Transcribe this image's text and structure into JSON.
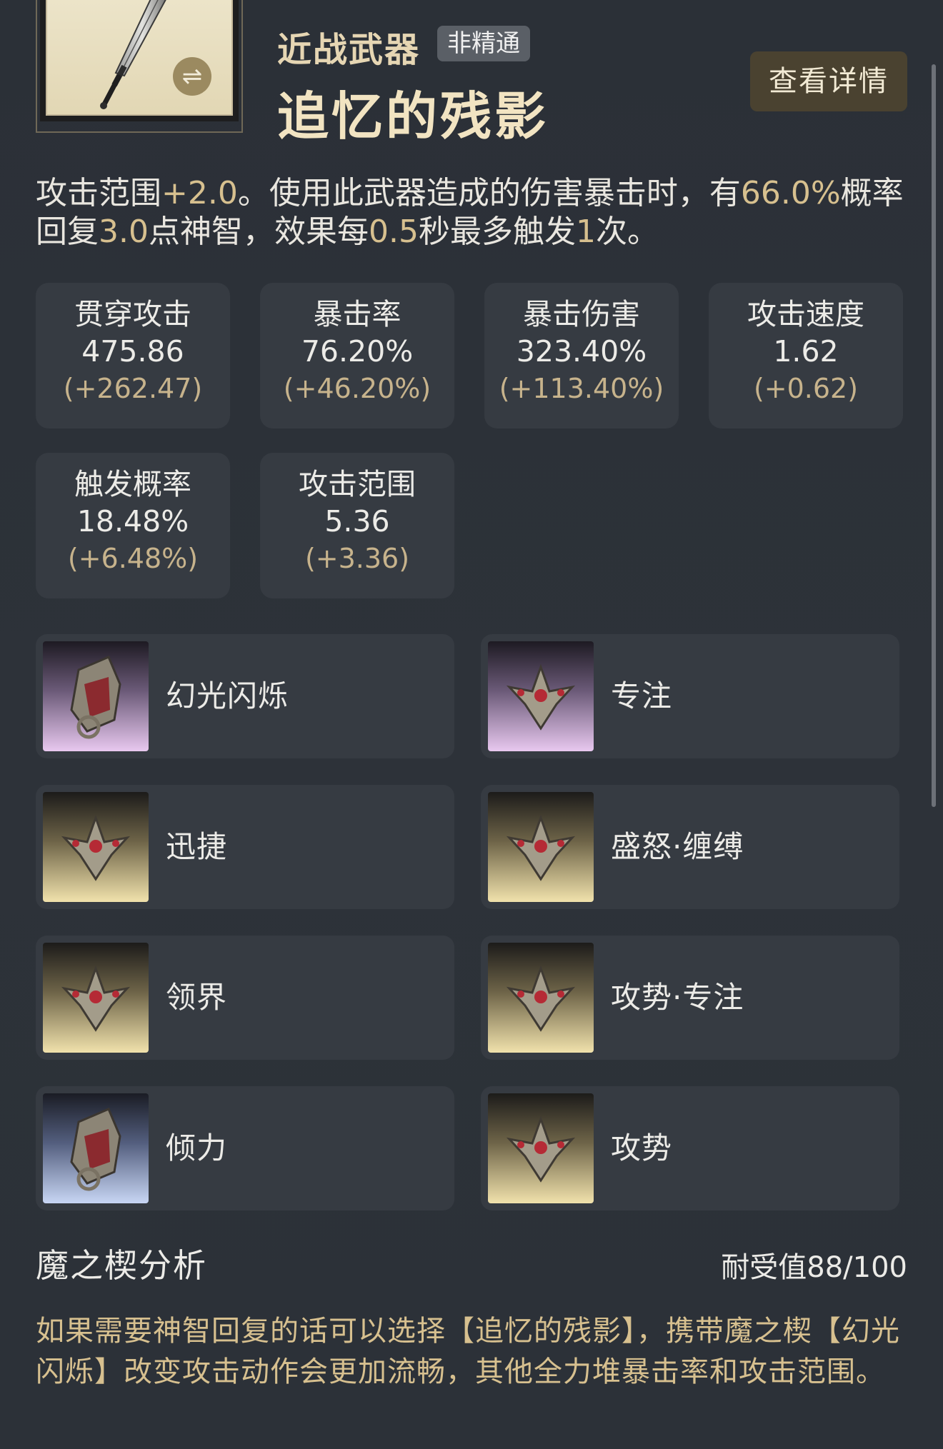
{
  "header": {
    "weapon_type": "近战武器",
    "badge": "非精通",
    "weapon_name": "追忆的残影",
    "detail_button": "查看详情",
    "swap_icon": "⇌"
  },
  "description": {
    "p1": "攻击范围",
    "v1": "+2.0",
    "p2": "。使用此武器造成的伤害暴击时，有",
    "v2": "66.0%",
    "p3": "概率回复",
    "v3": "3.0",
    "p4": "点神智，效果每",
    "v4": "0.5",
    "p5": "秒最多触发",
    "v5": "1",
    "p6": "次。"
  },
  "stats": [
    {
      "label": "贯穿攻击",
      "value": "475.86",
      "bonus": "(+262.47)"
    },
    {
      "label": "暴击率",
      "value": "76.20%",
      "bonus": "(+46.20%)"
    },
    {
      "label": "暴击伤害",
      "value": "323.40%",
      "bonus": "(+113.40%)"
    },
    {
      "label": "攻击速度",
      "value": "1.62",
      "bonus": "(+0.62)"
    },
    {
      "label": "触发概率",
      "value": "18.48%",
      "bonus": "(+6.48%)"
    },
    {
      "label": "攻击范围",
      "value": "5.36",
      "bonus": "(+3.36)"
    }
  ],
  "skills": [
    {
      "name": "幻光闪烁",
      "icon": "mask-icon",
      "tone": "purple"
    },
    {
      "name": "专注",
      "icon": "crest-icon",
      "tone": "purple"
    },
    {
      "name": "迅捷",
      "icon": "crest-icon",
      "tone": "gold"
    },
    {
      "name": "盛怒·缠缚",
      "icon": "crest-icon",
      "tone": "gold"
    },
    {
      "name": "领界",
      "icon": "crest-icon",
      "tone": "gold"
    },
    {
      "name": "攻势·专注",
      "icon": "crest-icon",
      "tone": "gold"
    },
    {
      "name": "倾力",
      "icon": "mask-icon",
      "tone": "blue"
    },
    {
      "name": "攻势",
      "icon": "crest-icon",
      "tone": "gold"
    }
  ],
  "analysis": {
    "title": "魔之楔分析",
    "durability": "耐受值88/100",
    "text": "如果需要神智回复的话可以选择【追忆的残影】，携带魔之楔【幻光闪烁】改变攻击动作会更加流畅，其他全力堆暴击率和攻击范围。"
  },
  "colors": {
    "background": "#2c3138",
    "card": "#363b42",
    "accent_gold": "#d7c08f",
    "button": "#4a4230"
  }
}
